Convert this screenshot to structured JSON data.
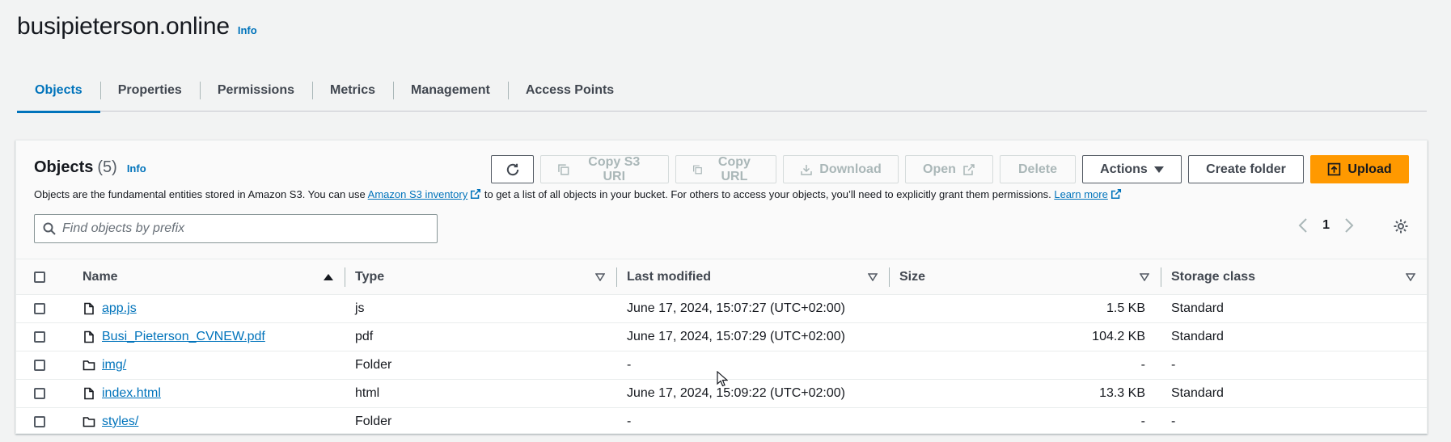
{
  "header": {
    "title": "busipieterson.online",
    "info": "Info"
  },
  "tabs": [
    {
      "label": "Objects",
      "active": true
    },
    {
      "label": "Properties"
    },
    {
      "label": "Permissions"
    },
    {
      "label": "Metrics"
    },
    {
      "label": "Management"
    },
    {
      "label": "Access Points"
    }
  ],
  "panel": {
    "title": "Objects",
    "count": "(5)",
    "info": "Info",
    "description": {
      "part1": "Objects are the fundamental entities stored in Amazon S3. You can use ",
      "link1": "Amazon S3 inventory",
      "part2": " to get a list of all objects in your bucket. For others to access your objects, you’ll need to explicitly grant them permissions. ",
      "link2": "Learn more"
    }
  },
  "toolbar": {
    "copy_s3_uri": "Copy S3 URI",
    "copy_url": "Copy URL",
    "download": "Download",
    "open": "Open",
    "delete": "Delete",
    "actions": "Actions",
    "create_folder": "Create folder",
    "upload": "Upload"
  },
  "search": {
    "placeholder": "Find objects by prefix"
  },
  "pagination": {
    "page": "1"
  },
  "table": {
    "columns": [
      "Name",
      "Type",
      "Last modified",
      "Size",
      "Storage class"
    ],
    "rows": [
      {
        "name": "app.js",
        "kind": "file",
        "type": "js",
        "modified": "June 17, 2024, 15:07:27 (UTC+02:00)",
        "size": "1.5 KB",
        "storage": "Standard"
      },
      {
        "name": "Busi_Pieterson_CVNEW.pdf",
        "kind": "file",
        "type": "pdf",
        "modified": "June 17, 2024, 15:07:29 (UTC+02:00)",
        "size": "104.2 KB",
        "storage": "Standard"
      },
      {
        "name": "img/",
        "kind": "folder",
        "type": "Folder",
        "modified": "-",
        "size": "-",
        "storage": "-"
      },
      {
        "name": "index.html",
        "kind": "file",
        "type": "html",
        "modified": "June 17, 2024, 15:09:22 (UTC+02:00)",
        "size": "13.3 KB",
        "storage": "Standard"
      },
      {
        "name": "styles/",
        "kind": "folder",
        "type": "Folder",
        "modified": "-",
        "size": "-",
        "storage": "-"
      }
    ]
  },
  "colors": {
    "link": "#0073bb",
    "primary": "#ff9900",
    "text": "#16191f"
  },
  "icons": [
    "refresh-icon",
    "copy-icon",
    "download-icon",
    "external-link-icon",
    "caret-down-icon",
    "upload-icon",
    "search-icon",
    "chevron-left-icon",
    "chevron-right-icon",
    "gear-icon",
    "file-icon",
    "folder-icon",
    "sort-ascending-icon",
    "sort-icon"
  ]
}
